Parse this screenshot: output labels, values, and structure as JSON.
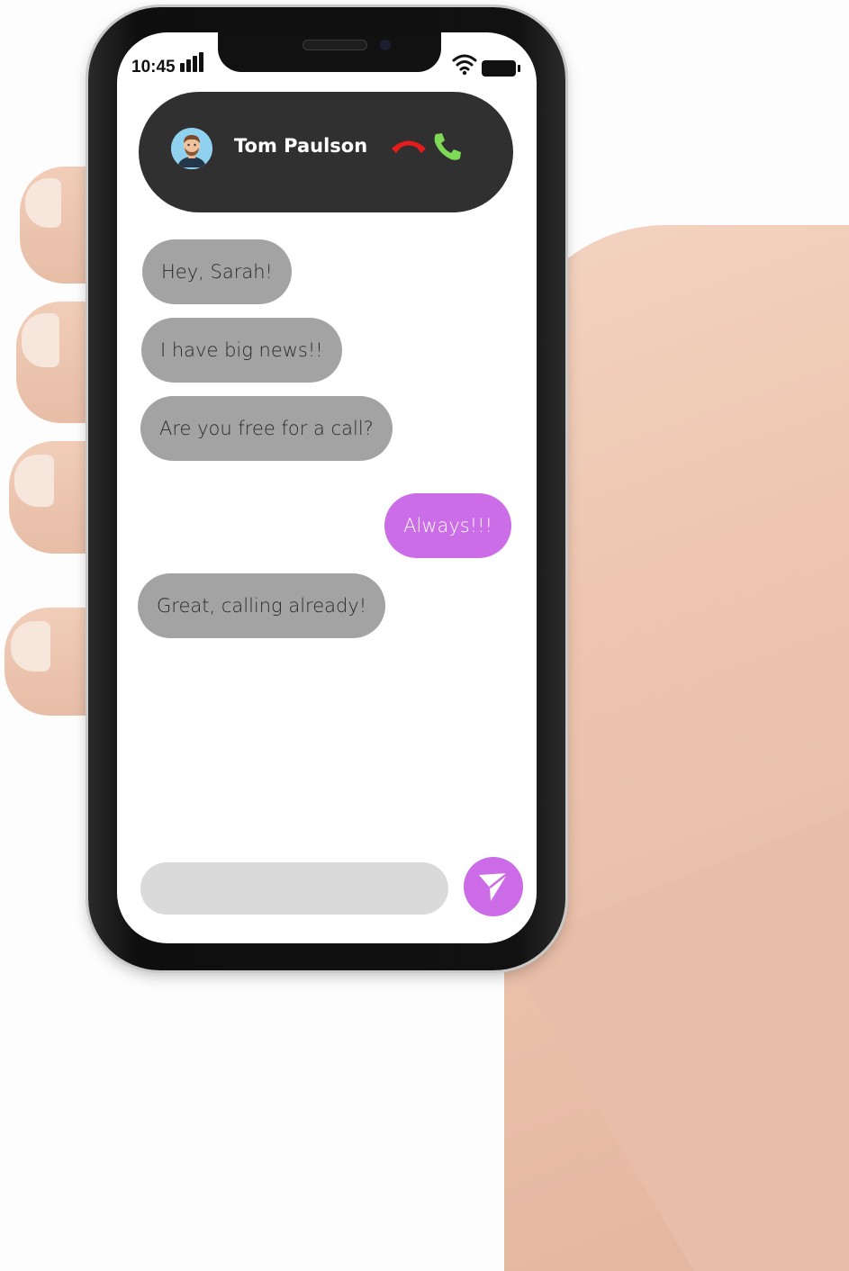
{
  "status_bar": {
    "time": "10:45"
  },
  "call_bar": {
    "contact_name": "Tom Paulson",
    "decline_color": "#e61c1c",
    "accept_color": "#7ed957"
  },
  "messages": [
    {
      "direction": "incoming",
      "text": "Hey, Sarah!"
    },
    {
      "direction": "incoming",
      "text": "I have big news!!"
    },
    {
      "direction": "incoming",
      "text": "Are you free for a call?"
    },
    {
      "direction": "outgoing",
      "text": "Always!!!"
    },
    {
      "direction": "incoming",
      "text": "Great, calling already!"
    }
  ],
  "composer": {
    "value": "",
    "placeholder": ""
  },
  "colors": {
    "incoming_bubble": "#a3a3a3",
    "outgoing_bubble": "#cc6de8",
    "call_bar": "#313031",
    "send_button": "#cb6ce6"
  },
  "icons": [
    "signal-icon",
    "wifi-icon",
    "battery-icon",
    "avatar",
    "decline-call-icon",
    "accept-call-icon",
    "send-icon"
  ]
}
